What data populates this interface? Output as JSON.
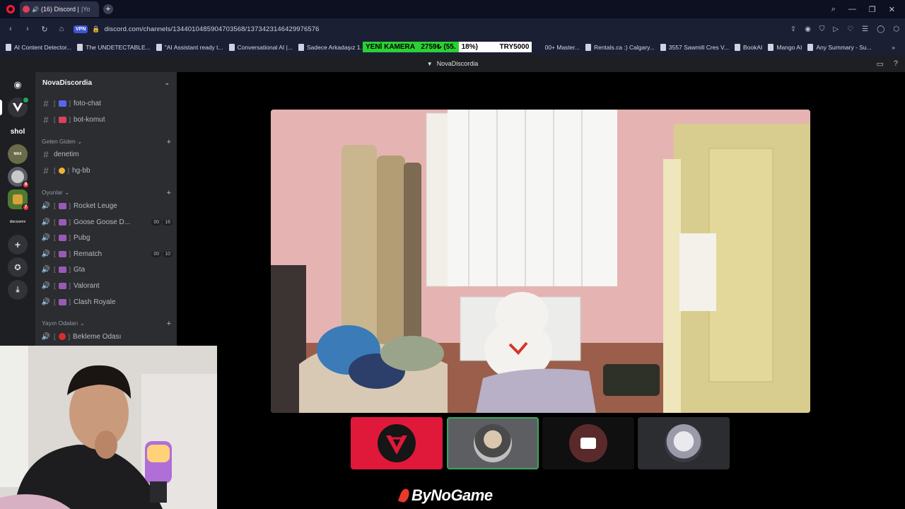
{
  "browser": {
    "tab_title": "(16) Discord | ",
    "tab_suffix": "|Yo",
    "new_tab": "+",
    "url": "discord.com/channels/1344010485904703568/1373423146429976576",
    "vpn": "VPN"
  },
  "bookmarks": [
    "AI Content Detector...",
    "The UNDETECTABLE...",
    "\"AI Assistant ready t...",
    "Conversational AI |...",
    "Sadece Arkadaşız 1...",
    "",
    "00+ Master...",
    "Rentals.ca :) Calgary...",
    "3557 Sawmill Cres V...",
    "BookAI",
    "Mango AI",
    "Any Summary - Su..."
  ],
  "ticker": {
    "label": "YENİ KAMERA",
    "amount": "2759₺",
    "pct_a": "(55.",
    "pct_b": "18%)",
    "goal": "TRY5000"
  },
  "discord": {
    "window_title": "NovaDiscordia",
    "server_name": "NovaDiscordia",
    "guilds": {
      "shol": "shol",
      "badge_1": "9",
      "badge_2": "7",
      "small_label": "discosmm"
    },
    "channels_top": [
      {
        "name": "foto-chat"
      },
      {
        "name": "bot-komut"
      }
    ],
    "cat_gelen": "Gelen Giden",
    "gelen_channels": [
      {
        "name": "denetim"
      },
      {
        "name": "hg-bb"
      }
    ],
    "cat_oyunlar": "Oyunlar",
    "voice_channels": [
      {
        "name": "Rocket Leuge"
      },
      {
        "name": "Goose Goose D...",
        "c1": "00",
        "c2": "16"
      },
      {
        "name": "Pubg"
      },
      {
        "name": "Rematch",
        "c1": "00",
        "c2": "10"
      },
      {
        "name": "Gta"
      },
      {
        "name": "Valorant"
      },
      {
        "name": "Clash Royale"
      }
    ],
    "cat_yayin": "Yayın Odaları",
    "yayin_channels": [
      {
        "name": "Bekleme Odası"
      }
    ]
  },
  "sponsor": "ByNoGame",
  "colors": {
    "tile_red": "#e0193a",
    "tile_selected_border": "#3ba55d",
    "ticker_green": "#2bd134"
  }
}
